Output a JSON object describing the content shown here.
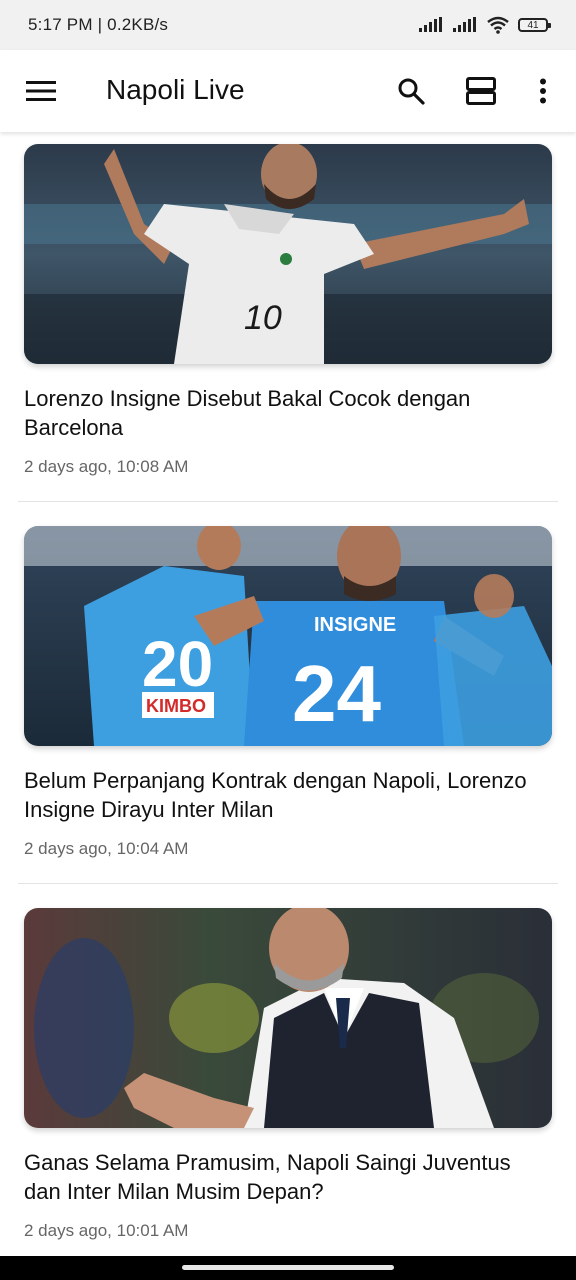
{
  "status_bar": {
    "text": "5:17 PM | 0.2KB/s",
    "battery": "41"
  },
  "app_bar": {
    "title": "Napoli Live",
    "icons": [
      "menu-icon",
      "search-icon",
      "view-layout-icon",
      "more-vert-icon"
    ]
  },
  "articles": [
    {
      "title": "Lorenzo Insigne Disebut Bakal Cocok dengan Barcelona",
      "time": "2 days ago, 10:08 AM"
    },
    {
      "title": "Belum Perpanjang Kontrak dengan Napoli, Lorenzo Insigne Dirayu Inter Milan",
      "time": "2 days ago, 10:04 AM"
    },
    {
      "title": "Ganas Selama Pramusim, Napoli Saingi Juventus dan Inter Milan Musim Depan?",
      "time": "2 days ago, 10:01 AM"
    }
  ],
  "colors": {
    "status_bar_bg": "#f1f1f1",
    "app_bar_bg": "#ffffff",
    "timestamp_text": "#666666",
    "divider": "#e3e3e3"
  }
}
